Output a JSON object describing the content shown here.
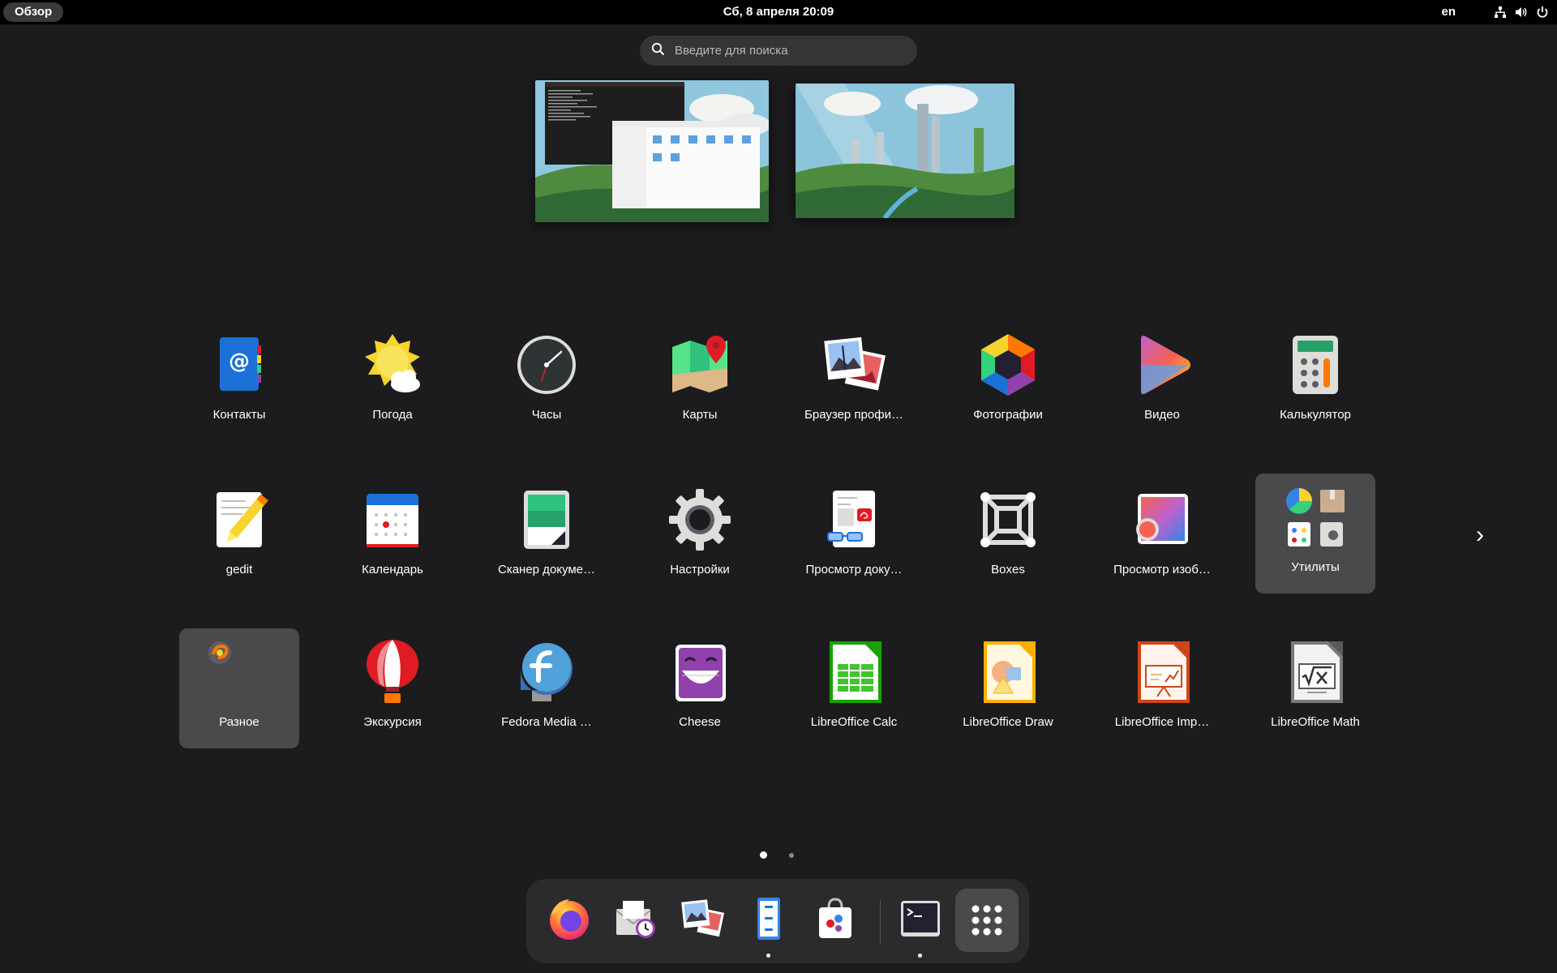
{
  "topbar": {
    "overview_label": "Обзор",
    "datetime": "Сб, 8 апреля  20:09",
    "keyboard_layout": "en",
    "icons": [
      "network-icon",
      "volume-icon",
      "power-icon"
    ]
  },
  "search": {
    "placeholder": "Введите для поиска"
  },
  "workspaces": [
    {
      "name": "workspace-1",
      "content": "terminal and file manager windows"
    },
    {
      "name": "workspace-2",
      "content": "empty desktop"
    }
  ],
  "apps": [
    {
      "label": "Контакты",
      "icon": "contacts-icon"
    },
    {
      "label": "Погода",
      "icon": "weather-icon"
    },
    {
      "label": "Часы",
      "icon": "clock-icon"
    },
    {
      "label": "Карты",
      "icon": "maps-icon"
    },
    {
      "label": "Браузер профи…",
      "icon": "image-browser-icon"
    },
    {
      "label": "Фотографии",
      "icon": "photos-icon"
    },
    {
      "label": "Видео",
      "icon": "video-icon"
    },
    {
      "label": "Калькулятор",
      "icon": "calculator-icon"
    },
    {
      "label": "gedit",
      "icon": "text-editor-icon"
    },
    {
      "label": "Календарь",
      "icon": "calendar-icon"
    },
    {
      "label": "Сканер докуме…",
      "icon": "scanner-icon"
    },
    {
      "label": "Настройки",
      "icon": "settings-gear-icon"
    },
    {
      "label": "Просмотр доку…",
      "icon": "document-viewer-icon"
    },
    {
      "label": "Boxes",
      "icon": "boxes-icon"
    },
    {
      "label": "Просмотр изоб…",
      "icon": "image-viewer-icon"
    },
    {
      "label": "Утилиты",
      "icon": "utilities-folder-icon"
    },
    {
      "label": "Разное",
      "icon": "misc-folder-icon"
    },
    {
      "label": "Экскурсия",
      "icon": "tour-balloon-icon"
    },
    {
      "label": "Fedora Media …",
      "icon": "fedora-media-writer-icon"
    },
    {
      "label": "Cheese",
      "icon": "cheese-icon"
    },
    {
      "label": "LibreOffice Calc",
      "icon": "libreoffice-calc-icon"
    },
    {
      "label": "LibreOffice Draw",
      "icon": "libreoffice-draw-icon"
    },
    {
      "label": "LibreOffice Imp…",
      "icon": "libreoffice-impress-icon"
    },
    {
      "label": "LibreOffice Math",
      "icon": "libreoffice-math-icon"
    }
  ],
  "pagination": {
    "pages": 2,
    "current": 1,
    "next_arrow": "›"
  },
  "dash": [
    {
      "name": "firefox",
      "icon": "firefox-icon",
      "running": false
    },
    {
      "name": "evolution",
      "icon": "mail-clock-icon",
      "running": false
    },
    {
      "name": "shotwell",
      "icon": "photo-gallery-icon",
      "running": false
    },
    {
      "name": "files",
      "icon": "file-cabinet-icon",
      "running": true
    },
    {
      "name": "software",
      "icon": "software-bag-icon",
      "running": false
    },
    {
      "name": "terminal",
      "icon": "terminal-icon",
      "running": true
    },
    {
      "name": "show-apps",
      "icon": "app-grid-icon",
      "running": false
    }
  ],
  "colors": {
    "background": "#1c1c1e",
    "topbar": "#000000",
    "folder": "#4a4a4c",
    "dash": "#2b2b2d"
  }
}
